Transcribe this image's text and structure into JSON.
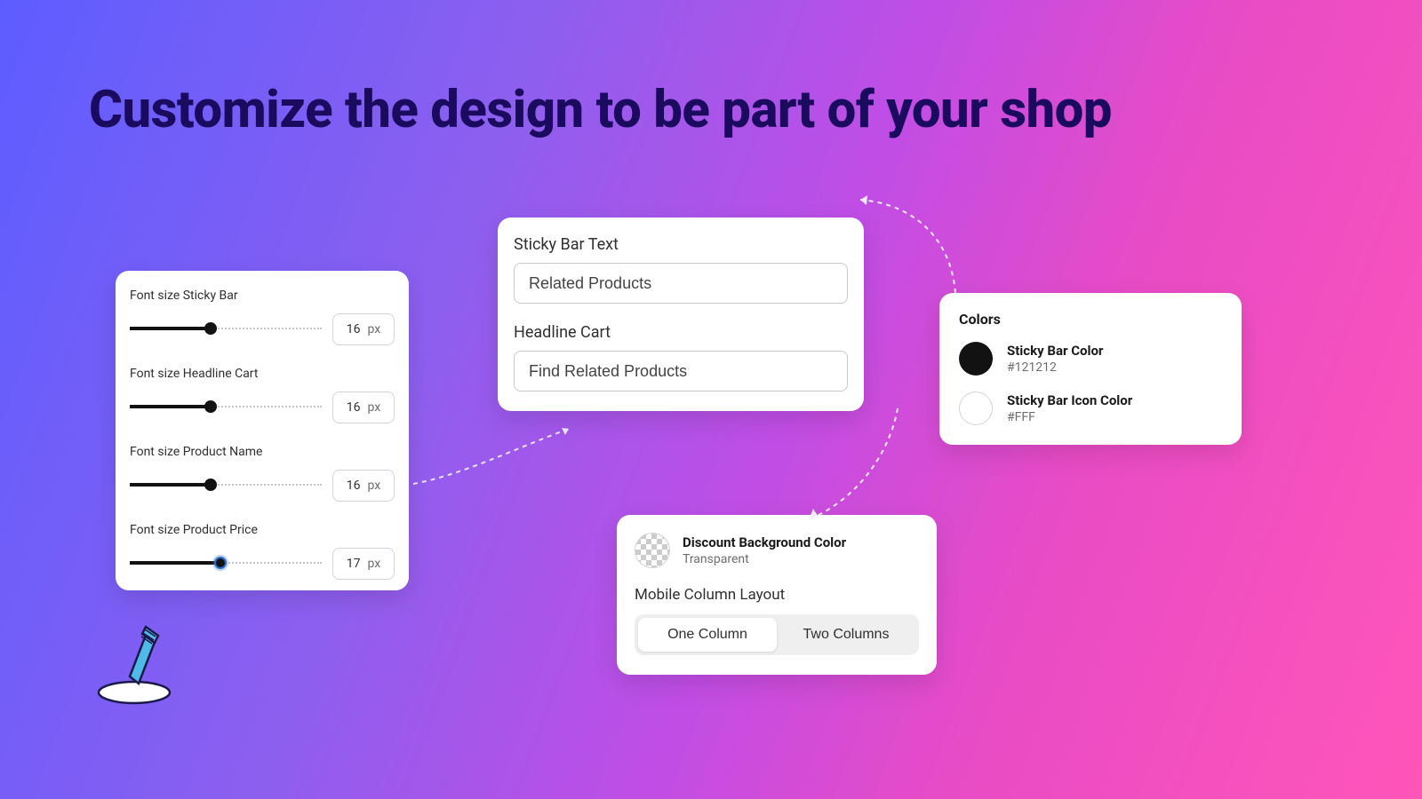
{
  "page": {
    "title": "Customize the design to be part of your shop"
  },
  "font_panel": {
    "items": [
      {
        "label": "Font size Sticky Bar",
        "value": "16",
        "unit": "px",
        "percent": 42,
        "focus": false
      },
      {
        "label": "Font size Headline Cart",
        "value": "16",
        "unit": "px",
        "percent": 42,
        "focus": false
      },
      {
        "label": "Font size Product Name",
        "value": "16",
        "unit": "px",
        "percent": 42,
        "focus": false
      },
      {
        "label": "Font size Product Price",
        "value": "17",
        "unit": "px",
        "percent": 47,
        "focus": true
      }
    ]
  },
  "text_panel": {
    "sticky_bar_label": "Sticky Bar Text",
    "sticky_bar_value": "Related Products",
    "headline_cart_label": "Headline Cart",
    "headline_cart_value": "Find Related Products"
  },
  "colors_panel": {
    "title": "Colors",
    "items": [
      {
        "name": "Sticky Bar Color",
        "hex": "#121212",
        "swatch": "dark"
      },
      {
        "name": "Sticky Bar Icon Color",
        "hex": "#FFF",
        "swatch": "white"
      }
    ]
  },
  "layout_panel": {
    "discount_label": "Discount Background Color",
    "discount_value": "Transparent",
    "mobile_label": "Mobile Column Layout",
    "options": [
      {
        "label": "One Column",
        "active": true
      },
      {
        "label": "Two Columns",
        "active": false
      }
    ]
  }
}
